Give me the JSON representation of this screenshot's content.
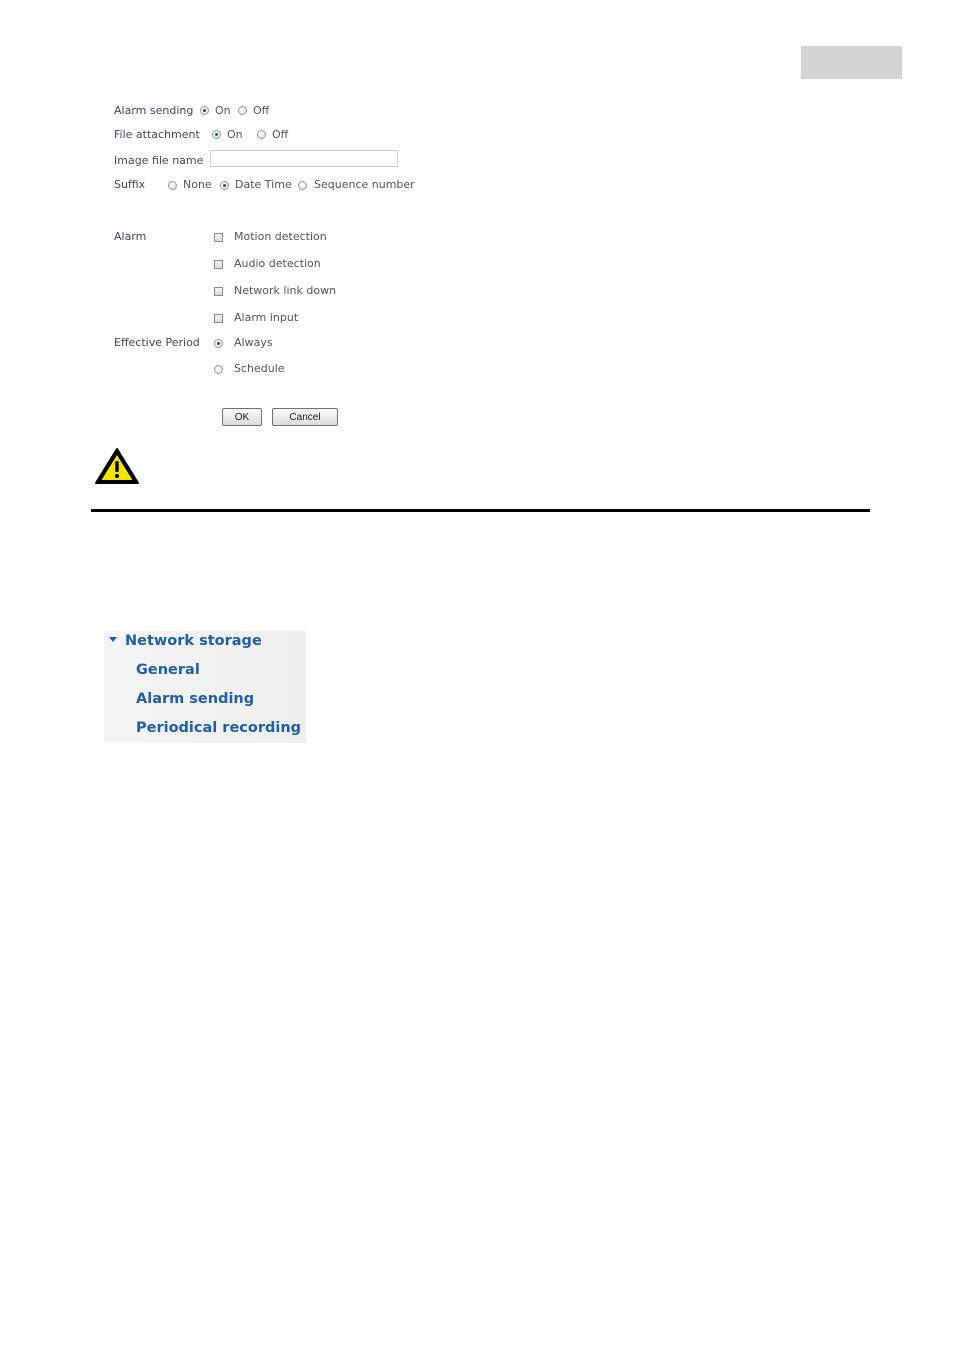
{
  "form": {
    "alarm_sending": {
      "label": "Alarm sending",
      "on": "On",
      "off": "Off",
      "selected": "On"
    },
    "file_attachment": {
      "label": "File attachment",
      "on": "On",
      "off": "Off",
      "selected": "On"
    },
    "image_file_name": {
      "label": "Image file name",
      "value": ""
    },
    "suffix": {
      "label": "Suffix",
      "none": "None",
      "date_time": "Date Time",
      "sequence": "Sequence number",
      "selected": "Date Time"
    },
    "alarm": {
      "label": "Alarm",
      "options": [
        "Motion detection",
        "Audio detection",
        "Network link down",
        "Alarm input"
      ]
    },
    "effective_period": {
      "label": "Effective Period",
      "always": "Always",
      "schedule": "Schedule",
      "selected": "Always"
    },
    "ok_label": "OK",
    "cancel_label": "Cancel"
  },
  "nav": {
    "section": "Network storage",
    "items": [
      "General",
      "Alarm sending",
      "Periodical recording"
    ]
  },
  "colors": {
    "nav_link": "#1f5ea8",
    "label": "#3f4a57",
    "warning": "#f2e600"
  }
}
